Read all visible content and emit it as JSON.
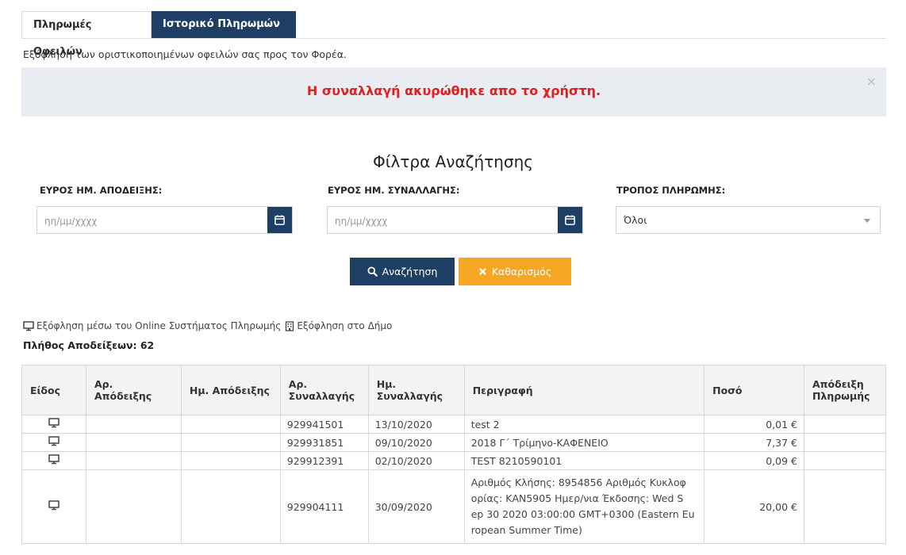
{
  "tabs": [
    {
      "label": "Πληρωμές Οφειλών"
    },
    {
      "label": "Ιστορικό Πληρωμών"
    }
  ],
  "subtitle": "Εξόφληση των οριστικοποιημένων οφειλών σας προς τον Φορέα.",
  "alert": {
    "message": "Η συναλλαγή ακυρώθηκε απο το χρήστη.",
    "close": "×"
  },
  "filters": {
    "title": "Φίλτρα Αναζήτησης",
    "receipt_range_label": "ΕΥΡΟΣ ΗΜ. ΑΠΟΔΕΙΞΗΣ:",
    "transaction_range_label": "ΕΥΡΟΣ ΗΜ. ΣΥΝΑΛΛΑΓΗΣ:",
    "payment_method_label": "ΤΡΟΠΟΣ ΠΛΗΡΩΜΗΣ:",
    "date_placeholder": "ηη/μμ/χχχχ",
    "payment_method_value": "Όλοι",
    "search_button": "Αναζήτηση",
    "clear_button": "Καθαρισμός"
  },
  "legend": {
    "online": "Εξόφληση μέσω του Online Συστήματος Πληρωμής",
    "municipality": "Εξόφληση στο Δήμο"
  },
  "count_label": "Πλήθος Αποδείξεων: 62",
  "table": {
    "headers": {
      "type": "Είδος",
      "receipt_no": "Αρ. Απόδειξης",
      "receipt_date": "Ημ. Απόδειξης",
      "transaction_no": "Αρ. Συναλλαγής",
      "transaction_date": "Ημ. Συναλλαγής",
      "description": "Περιγραφή",
      "amount": "Ποσό",
      "proof": "Απόδειξη Πληρωμής"
    },
    "rows": [
      {
        "transaction_no": "929941501",
        "transaction_date": "13/10/2020",
        "description": "test 2",
        "amount": "0,01 €"
      },
      {
        "transaction_no": "929931851",
        "transaction_date": "09/10/2020",
        "description": "2018 Γ΄ Τρίμηνο-ΚΑΦΕΝΕΙΟ",
        "amount": "7,37 €"
      },
      {
        "transaction_no": "929912391",
        "transaction_date": "02/10/2020",
        "description": "TEST 8210590101",
        "amount": "0,09 €"
      },
      {
        "transaction_no": "929904111",
        "transaction_date": "30/09/2020",
        "description": "Αριθμός Κλήσης: 8954856 Αριθμός Κυκλοφ ορίας: ΚΑΝ5905 Ημερ/νια Έκδοσης: Wed S ep 30 2020 03:00:00 GMT+0300 (Eastern Eu ropean Summer Time)",
        "amount": "20,00 €"
      }
    ]
  },
  "colors": {
    "primary": "#1f3e63",
    "warning": "#f5a623",
    "danger": "#e02020",
    "alert_bg": "#e9edf1"
  }
}
